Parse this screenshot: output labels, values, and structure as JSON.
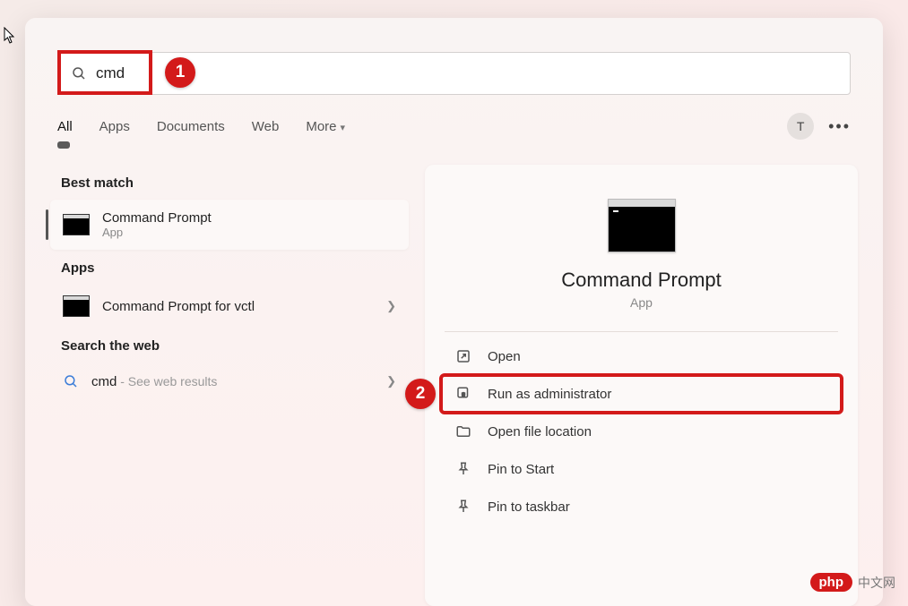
{
  "search": {
    "value": "cmd"
  },
  "tabs": {
    "all": "All",
    "apps": "Apps",
    "documents": "Documents",
    "web": "Web",
    "more": "More"
  },
  "avatar_letter": "T",
  "more_dots": "•••",
  "sections": {
    "best_match": "Best match",
    "apps": "Apps",
    "search_web": "Search the web"
  },
  "best_match_item": {
    "title": "Command Prompt",
    "subtitle": "App"
  },
  "apps_list": {
    "vctl": "Command Prompt for vctl"
  },
  "web_search": {
    "query": "cmd",
    "suffix": " - See web results"
  },
  "detail": {
    "title": "Command Prompt",
    "subtitle": "App"
  },
  "actions": {
    "open": "Open",
    "run_admin": "Run as administrator",
    "file_loc": "Open file location",
    "pin_start": "Pin to Start",
    "pin_taskbar": "Pin to taskbar"
  },
  "annotations": {
    "badge1": "1",
    "badge2": "2"
  },
  "watermark": {
    "logo": "php",
    "text": "中文网"
  }
}
